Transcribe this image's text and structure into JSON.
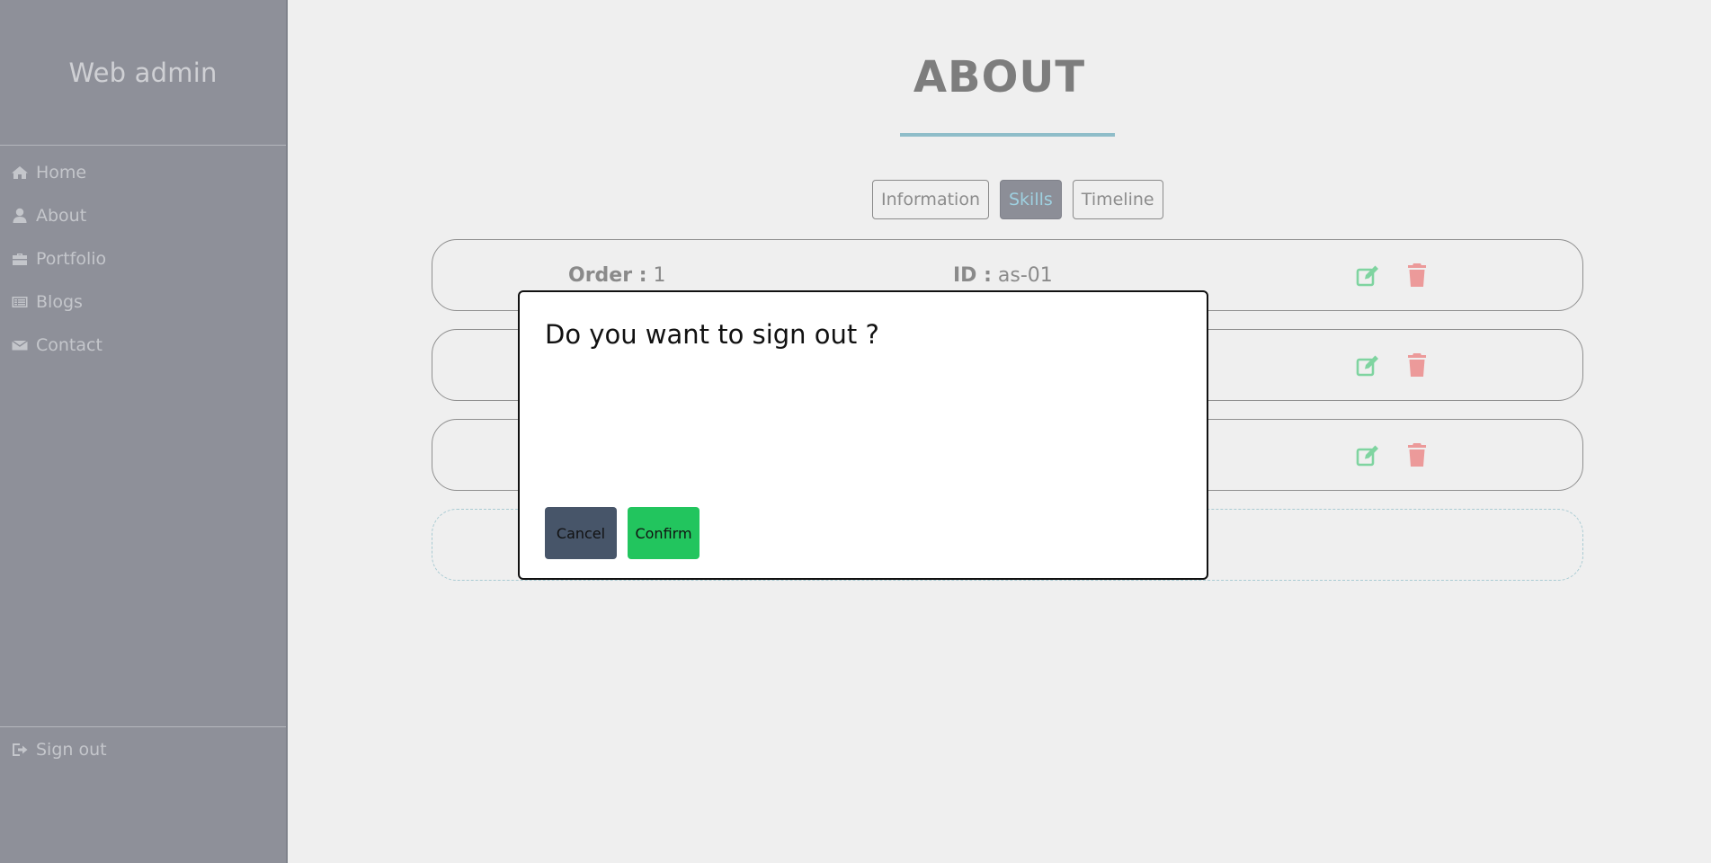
{
  "sidebar": {
    "brand": "Web admin",
    "items": [
      {
        "label": "Home",
        "icon": "home-icon"
      },
      {
        "label": "About",
        "icon": "user-icon"
      },
      {
        "label": "Portfolio",
        "icon": "briefcase-icon"
      },
      {
        "label": "Blogs",
        "icon": "list-icon"
      },
      {
        "label": "Contact",
        "icon": "envelope-icon"
      }
    ],
    "signout": {
      "label": "Sign out",
      "icon": "sign-out-icon"
    }
  },
  "main": {
    "title": "ABOUT",
    "tabs": [
      {
        "label": "Information",
        "active": false
      },
      {
        "label": "Skills",
        "active": true
      },
      {
        "label": "Timeline",
        "active": false
      }
    ],
    "rows": [
      {
        "order_label": "Order :",
        "order_value": "1",
        "id_label": "ID :",
        "id_value": "as-01"
      }
    ]
  },
  "modal": {
    "message": "Do you want to sign out ?",
    "cancel_label": "Cancel",
    "confirm_label": "Confirm"
  },
  "colors": {
    "sidebar_bg": "#8e9099",
    "accent": "#8fbdc9",
    "edit": "#7fd4a0",
    "delete": "#ec9a9a",
    "cancel": "#475569",
    "confirm": "#22c55e"
  }
}
